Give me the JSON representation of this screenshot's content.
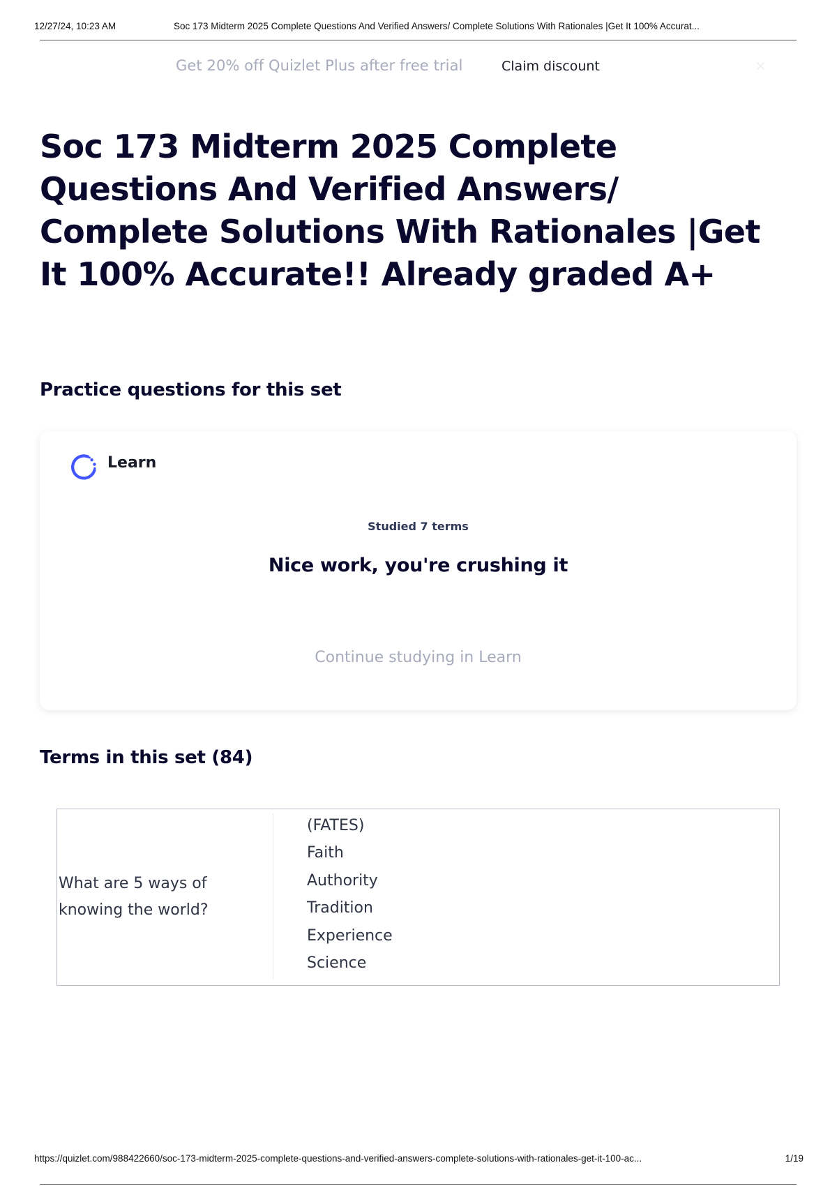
{
  "print_header": {
    "date": "12/27/24, 10:23 AM",
    "doc_title": "Soc 173 Midterm 2025 Complete Questions And Verified Answers/ Complete Solutions With Rationales |Get It 100% Accurat..."
  },
  "promo": {
    "text": "Get 20% off Quizlet Plus after free trial",
    "claim_label": "Claim discount",
    "close_glyph": "×"
  },
  "set_title": "Soc 173 Midterm 2025 Complete Questions And Verified Answers/ Complete Solutions With Rationales |Get It 100% Accurate!! Already graded A+",
  "practice": {
    "heading": "Practice questions for this set",
    "learn": {
      "label": "Learn",
      "icon": "learn-progress-icon",
      "icon_color": "#4255ff",
      "studied": "Studied 7 terms",
      "message": "Nice work, you're crushing it",
      "continue_label": "Continue studying in Learn"
    }
  },
  "terms": {
    "heading": "Terms in this set (84)",
    "items": [
      {
        "question": "What are 5 ways of knowing the world?",
        "answer_lines": [
          "(FATES)",
          "Faith",
          "Authority",
          "Tradition",
          "Experience",
          "Science"
        ]
      }
    ]
  },
  "print_footer": {
    "url": "https://quizlet.com/988422660/soc-173-midterm-2025-complete-questions-and-verified-answers-complete-solutions-with-rationales-get-it-100-ac...",
    "page": "1/19"
  }
}
